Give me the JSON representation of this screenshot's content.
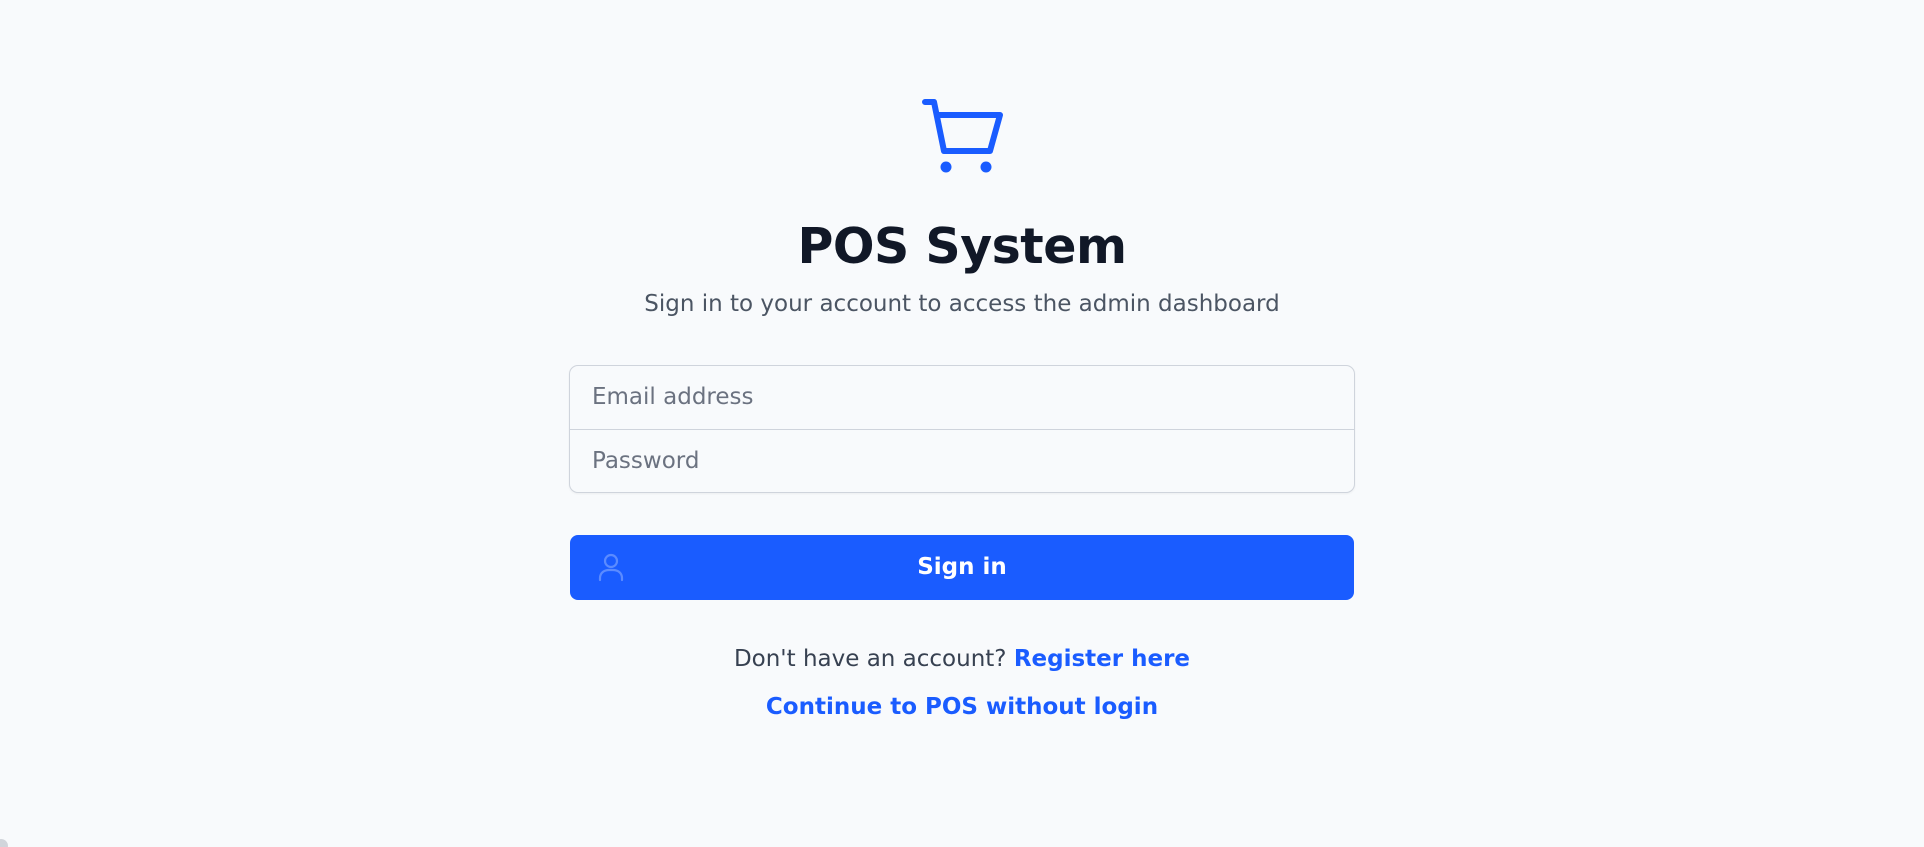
{
  "header": {
    "logo_icon": "shopping-cart-icon",
    "title": "POS System",
    "subtitle": "Sign in to your account to access the admin dashboard"
  },
  "form": {
    "email_placeholder": "Email address",
    "email_value": "",
    "password_placeholder": "Password",
    "password_value": "",
    "submit_label": "Sign in",
    "submit_icon": "user-icon"
  },
  "footer": {
    "register_prompt": "Don't have an account?",
    "register_link": "Register here",
    "continue_link": "Continue to POS without login"
  },
  "colors": {
    "background": "#f8fafc",
    "accent": "#1a5cff",
    "title": "#111827",
    "muted_text": "#4b5563"
  }
}
